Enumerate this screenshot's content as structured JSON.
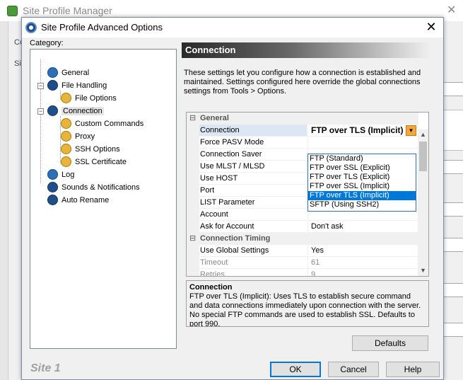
{
  "background_window": {
    "title": "Site Profile Manager",
    "close_glyph": "✕",
    "partial_label_1": "Co",
    "partial_label_2": "Sit"
  },
  "dialog": {
    "title": "Site Profile Advanced Options",
    "close_glyph": "✕",
    "category_label": "Category:",
    "site_label": "Site 1"
  },
  "tree": {
    "items": [
      {
        "label": "General",
        "icon": "general-icon"
      },
      {
        "label": "File Handling",
        "icon": "file-handling-icon"
      },
      {
        "label": "File Options",
        "icon": "file-options-icon"
      },
      {
        "label": "Connection",
        "icon": "connection-icon"
      },
      {
        "label": "Custom Commands",
        "icon": "custom-commands-icon"
      },
      {
        "label": "Proxy",
        "icon": "proxy-icon"
      },
      {
        "label": "SSH Options",
        "icon": "ssh-options-icon"
      },
      {
        "label": "SSL Certificate",
        "icon": "ssl-certificate-icon"
      },
      {
        "label": "Log",
        "icon": "log-icon"
      },
      {
        "label": "Sounds & Notifications",
        "icon": "sounds-icon"
      },
      {
        "label": "Auto Rename",
        "icon": "auto-rename-icon"
      }
    ],
    "expander_minus": "−"
  },
  "panel": {
    "header": "Connection",
    "description": "These settings let you configure how a connection is established and maintained. Settings configured here override the global connections settings from Tools > Options."
  },
  "grid": {
    "categories": {
      "general": "General",
      "timing": "Connection Timing"
    },
    "expander": "⊟",
    "rows": [
      {
        "name": "Connection",
        "value": "FTP over TLS (Implicit)"
      },
      {
        "name": "Force PASV Mode",
        "value": ""
      },
      {
        "name": "Connection Saver",
        "value": ""
      },
      {
        "name": "Use MLST / MLSD",
        "value": ""
      },
      {
        "name": "Use HOST",
        "value": ""
      },
      {
        "name": "Port",
        "value": ""
      },
      {
        "name": "LIST Parameter",
        "value": ""
      },
      {
        "name": "Account",
        "value": ""
      },
      {
        "name": "Ask for Account",
        "value": "Don't ask"
      }
    ],
    "timing_rows": [
      {
        "name": "Use Global Settings",
        "value": "Yes"
      },
      {
        "name": "Timeout",
        "value": "61"
      },
      {
        "name": "Retries",
        "value": "9"
      }
    ]
  },
  "dropdown": {
    "options": [
      "FTP (Standard)",
      "FTP over SSL (Explicit)",
      "FTP over TLS (Explicit)",
      "FTP over SSL (Implicit)",
      "FTP over TLS (Implicit)",
      "SFTP (Using SSH2)"
    ],
    "selected_index": 4
  },
  "description_box": {
    "title": "Connection",
    "body": "FTP over TLS (Implicit): Uses TLS to establish secure command and data connections immediately upon connection with the server. No special FTP commands are used to establish SSL. Defaults to port 990."
  },
  "buttons": {
    "defaults": "Defaults",
    "ok": "OK",
    "cancel": "Cancel",
    "help": "Help"
  },
  "colors": {
    "dropdown_selected": "#0078d7",
    "combo_button": "#f6a73b",
    "panel_header_dark": "#2a2a2a"
  }
}
